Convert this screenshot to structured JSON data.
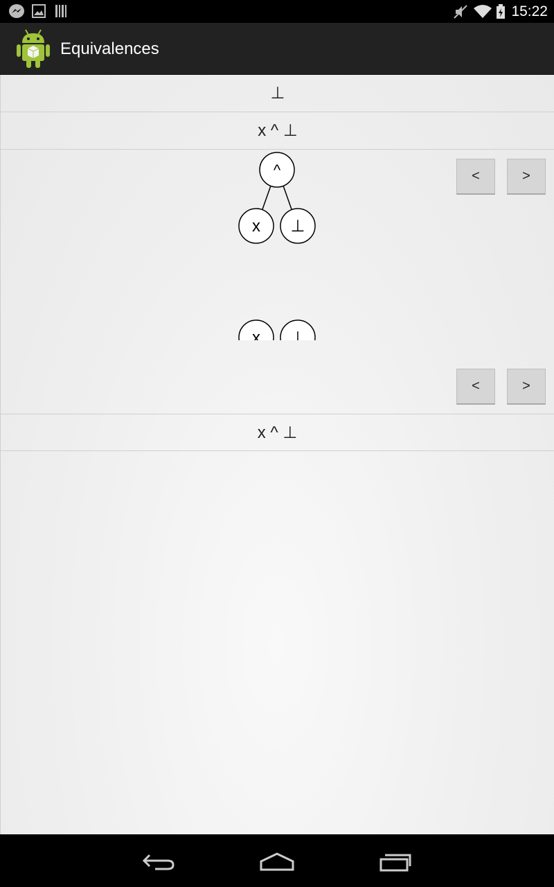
{
  "status_bar": {
    "time": "15:22",
    "icons": [
      "messenger-icon",
      "image-icon",
      "barcode-icon",
      "mute-icon",
      "wifi-icon",
      "battery-icon"
    ]
  },
  "action_bar": {
    "title": "Equivalences",
    "icon": "android-app-icon"
  },
  "content": {
    "rows": [
      {
        "formula": "⊥"
      },
      {
        "formula": "x ^ ⊥"
      }
    ],
    "tree_top": {
      "root": "^",
      "children": [
        "x",
        "⊥"
      ],
      "prev_label": "<",
      "next_label": ">"
    },
    "tree_bottom": {
      "root": "^",
      "children": [
        "x",
        "⊥"
      ],
      "prev_label": "<",
      "next_label": ">"
    },
    "bottom_row": {
      "formula": "x ^ ⊥"
    }
  },
  "nav_bar": {
    "buttons": [
      "back-icon",
      "home-icon",
      "recents-icon"
    ]
  },
  "colors": {
    "status_bar_bg": "#000000",
    "action_bar_bg": "#222222",
    "content_bg": "#efefef",
    "button_bg": "#d6d6d6",
    "android_green": "#9fc33a"
  }
}
